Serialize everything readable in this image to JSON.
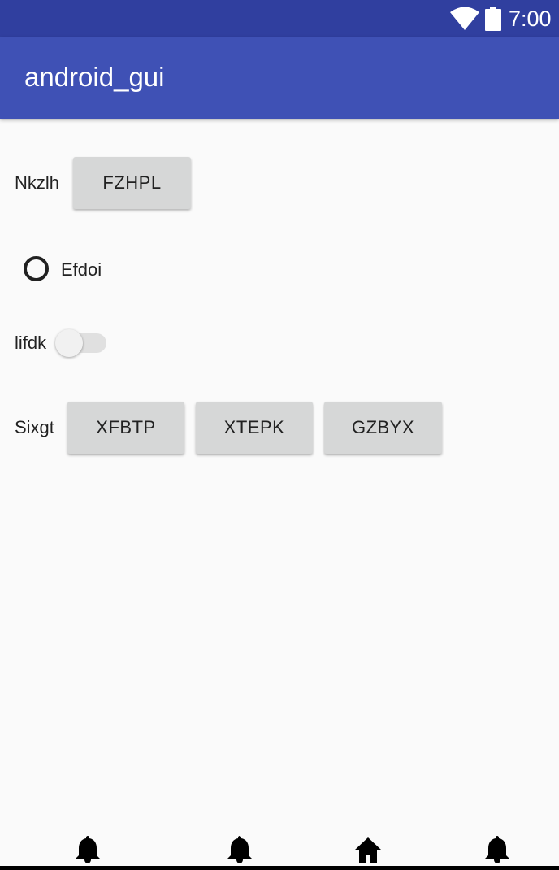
{
  "status_bar": {
    "time": "7:00",
    "icons": [
      "wifi-icon",
      "battery-icon"
    ]
  },
  "app_bar": {
    "title": "android_gui",
    "color": "#3f51b5",
    "status_color": "#303f9f"
  },
  "rows": {
    "row1": {
      "label": "Nkzlh",
      "button": "FZHPL"
    },
    "radio": {
      "label": "Efdoi",
      "checked": false
    },
    "switch": {
      "label": "lifdk",
      "on": false
    },
    "row4": {
      "label": "Sixgt",
      "buttons": [
        "XFBTP",
        "XTEPK",
        "GZBYX"
      ]
    }
  },
  "bottom_nav": {
    "items": [
      "bell-icon",
      "bell-icon",
      "home-icon",
      "bell-icon"
    ]
  }
}
